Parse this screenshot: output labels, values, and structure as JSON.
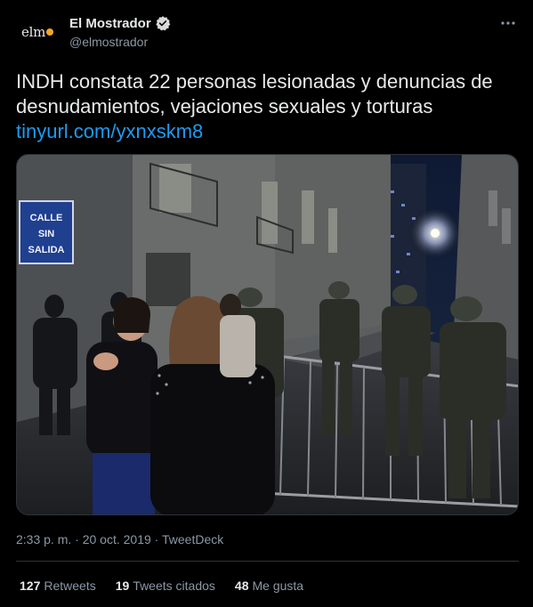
{
  "author": {
    "display_name": "El Mostrador",
    "handle": "@elmostrador",
    "avatar_text": "elm",
    "verified_icon": "verified-badge-icon"
  },
  "tweet": {
    "text": "INDH constata 22 personas lesionadas y denuncias de desnudamientos, vejaciones sexuales y torturas",
    "link": "tinyurl.com/yxnxskm8"
  },
  "media": {
    "description_icon": "photo",
    "sign_lines": [
      "CALLE",
      "SIN",
      "SALIDA"
    ]
  },
  "meta": {
    "time": "2:33 p. m.",
    "separator": "·",
    "date": "20 oct. 2019",
    "source": "TweetDeck"
  },
  "stats": [
    {
      "count": "127",
      "label": "Retweets"
    },
    {
      "count": "19",
      "label": "Tweets citados"
    },
    {
      "count": "48",
      "label": "Me gusta"
    }
  ],
  "colors": {
    "background": "#000000",
    "link": "#1d9bf0",
    "secondary_text": "#8b98a5",
    "verified": "#d9d9d9"
  }
}
